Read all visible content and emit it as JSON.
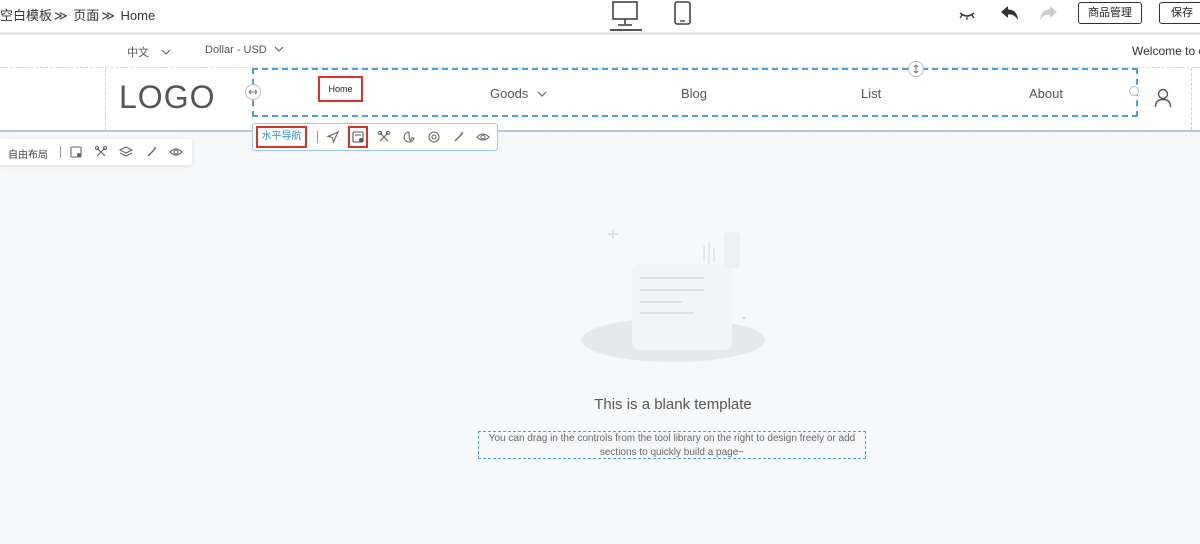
{
  "breadcrumb": {
    "items": [
      "空白模板",
      "页面",
      "Home"
    ],
    "separator": "≫"
  },
  "toolbar": {
    "device_desktop": "desktop-icon",
    "device_mobile": "mobile-icon",
    "manage_label": "商品管理",
    "save_label": "保存"
  },
  "langbar": {
    "language": "中文",
    "currency": "Dollar - USD",
    "welcome": "Welcome to o"
  },
  "header": {
    "logo": "LOGO",
    "nav": [
      {
        "label": "Home"
      },
      {
        "label": "Goods"
      },
      {
        "label": "Blog"
      },
      {
        "label": "List"
      },
      {
        "label": "About"
      }
    ]
  },
  "nav_toolbar": {
    "label": "水平导航"
  },
  "free_toolbar": {
    "label": "自由布局"
  },
  "empty_state": {
    "title": "This is a blank template",
    "desc_line1": "You can drag in the controls from the tool library on the right to design freely or add",
    "desc_line2": "sections to quickly build a page~"
  },
  "colors": {
    "accent": "#2e8fe0",
    "highlight": "#d9322a"
  }
}
